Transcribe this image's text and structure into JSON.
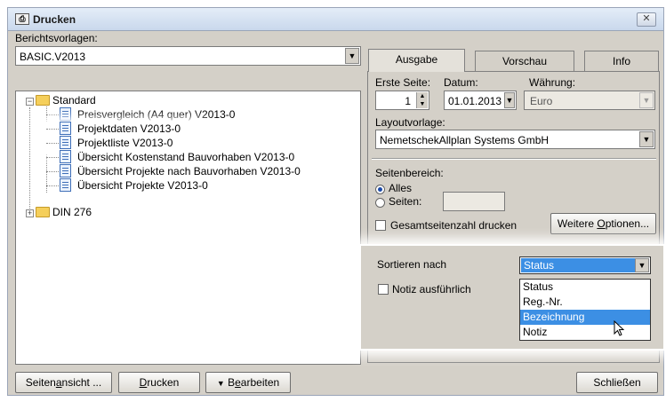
{
  "window": {
    "title": "Drucken",
    "close_glyph": "✕"
  },
  "left": {
    "templates_label": "Berichtsvorlagen:",
    "template_value": "BASIC.V2013",
    "tree": {
      "group1": "Standard",
      "items": [
        "Preisvergleich (A4 quer) V2013-0",
        "Projektdaten V2013-0",
        "Projektliste V2013-0",
        "Übersicht Kostenstand Bauvorhaben V2013-0",
        "Übersicht Projekte nach Bauvorhaben V2013-0",
        "Übersicht Projekte V2013-0"
      ],
      "group2": "DIN 276"
    }
  },
  "bottom": {
    "preview_prefix": "Seiten",
    "preview_key": "a",
    "preview_suffix": "nsicht ...",
    "print_key": "D",
    "print_suffix": "rucken",
    "edit_prefix": "B",
    "edit_key": "e",
    "edit_suffix": "arbeiten",
    "close": "Schließen"
  },
  "tabs": [
    "Ausgabe",
    "Vorschau",
    "Info"
  ],
  "output": {
    "first_page_label": "Erste Seite:",
    "first_page_value": "1",
    "date_label": "Datum:",
    "date_value": "01.01.2013",
    "currency_label": "Währung:",
    "currency_value": "Euro",
    "layout_label": "Layoutvorlage:",
    "layout_value": "NemetschekAllplan Systems GmbH",
    "range_label": "Seitenbereich:",
    "all_label": "Alles",
    "pages_label": "Seiten:",
    "total_pages_label": "Gesamtseitenzahl drucken",
    "more_options_prefix": "Weitere ",
    "more_options_key": "O",
    "more_options_suffix": "ptionen...",
    "sort_label": "Sortieren nach",
    "sort_value": "Status",
    "note_label": "Notiz ausführlich",
    "sort_options": [
      "Status",
      "Reg.-Nr.",
      "Bezeichnung",
      "Notiz"
    ],
    "sort_hovered": "Bezeichnung"
  },
  "colors": {
    "selection": "#3c8fe4",
    "dialog_bg": "#d4d0c8"
  }
}
